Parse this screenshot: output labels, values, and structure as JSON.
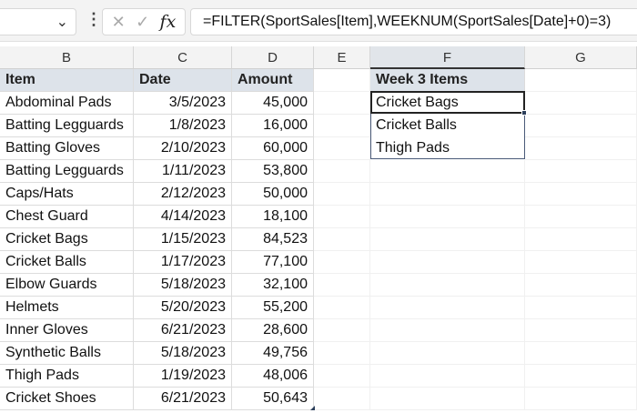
{
  "formula_bar": {
    "formula": "=FILTER(SportSales[Item],WEEKNUM(SportSales[Date]+0)=3)",
    "fx_label": "fx"
  },
  "columns": [
    "B",
    "C",
    "D",
    "E",
    "F",
    "G"
  ],
  "table": {
    "headers": [
      "Item",
      "Date",
      "Amount"
    ],
    "rows": [
      [
        "Abdominal Pads",
        "3/5/2023",
        "45,000"
      ],
      [
        "Batting Legguards",
        "1/8/2023",
        "16,000"
      ],
      [
        "Batting Gloves",
        "2/10/2023",
        "60,000"
      ],
      [
        "Batting Legguards",
        "1/11/2023",
        "53,800"
      ],
      [
        "Caps/Hats",
        "2/12/2023",
        "50,000"
      ],
      [
        "Chest Guard",
        "4/14/2023",
        "18,100"
      ],
      [
        "Cricket Bags",
        "1/15/2023",
        "84,523"
      ],
      [
        "Cricket Balls",
        "1/17/2023",
        "77,100"
      ],
      [
        "Elbow Guards",
        "5/18/2023",
        "32,100"
      ],
      [
        "Helmets",
        "5/20/2023",
        "55,200"
      ],
      [
        "Inner Gloves",
        "6/21/2023",
        "28,600"
      ],
      [
        "Synthetic Balls",
        "5/18/2023",
        "49,756"
      ],
      [
        "Thigh Pads",
        "1/19/2023",
        "48,006"
      ],
      [
        "Cricket Shoes",
        "6/21/2023",
        "50,643"
      ]
    ]
  },
  "result": {
    "header": "Week 3 Items",
    "items": [
      "Cricket Bags",
      "Cricket Balls",
      "Thigh Pads"
    ]
  }
}
